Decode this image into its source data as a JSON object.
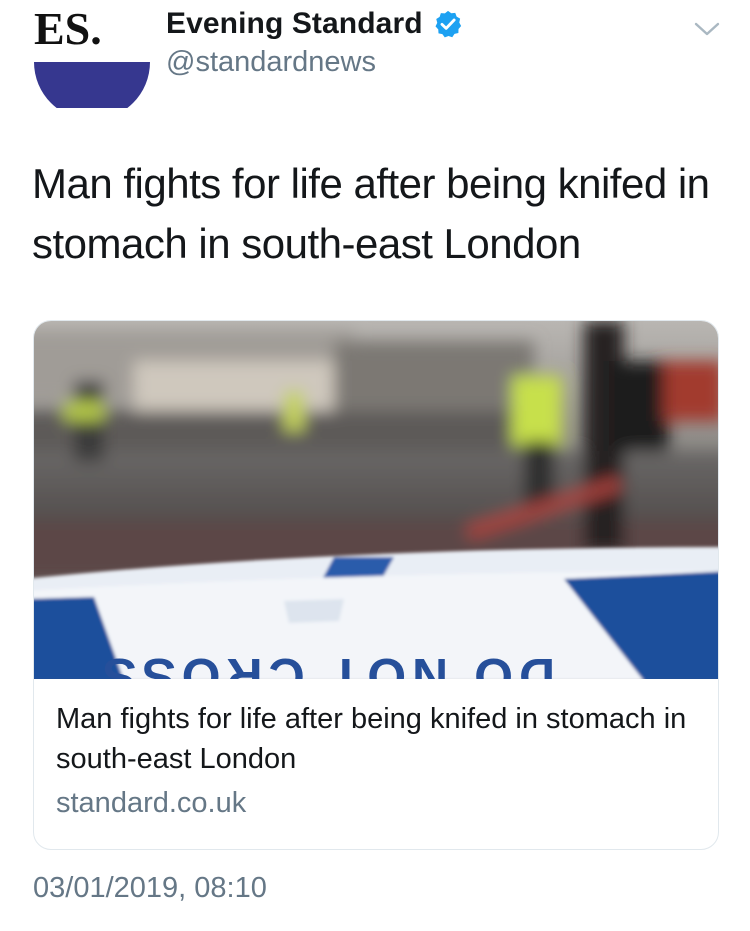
{
  "author": {
    "avatar_text": "ES.",
    "display_name": "Evening Standard",
    "handle": "@standardnews",
    "verified": true,
    "avatar_colors": {
      "text": "#111111",
      "dot": "#e0161b",
      "circle": "#36378f"
    }
  },
  "tweet": {
    "text": "Man fights for life after being knifed in stomach in south-east London",
    "timestamp": "03/01/2019, 08:10"
  },
  "card": {
    "title": "Man fights for life after being knifed in stomach in south-east London",
    "domain": "standard.co.uk",
    "image_tape_text": "DO NOT CROSS"
  },
  "icons": {
    "verified": "verified-badge-icon",
    "menu": "chevron-down-icon"
  },
  "colors": {
    "verified_blue": "#1da1f2",
    "secondary_text": "#657786",
    "tape_blue": "#1f4f9c"
  }
}
